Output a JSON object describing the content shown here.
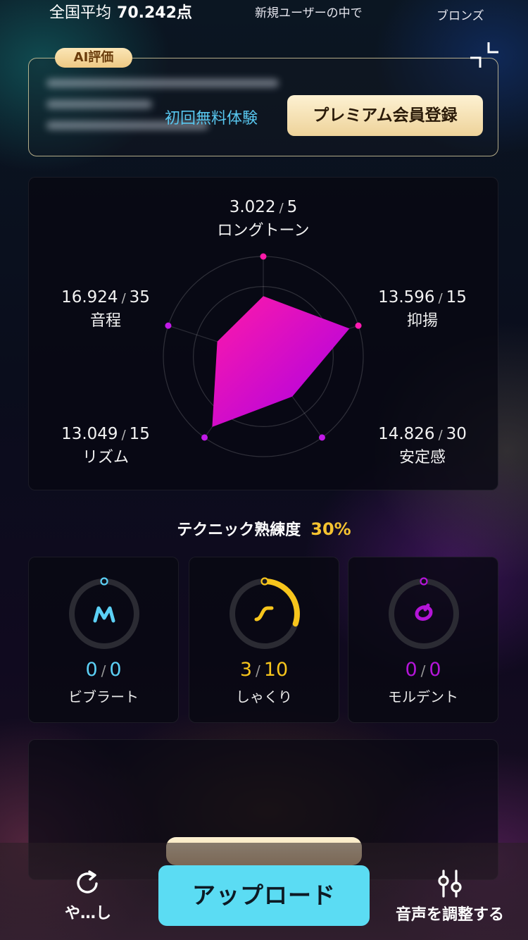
{
  "header": {
    "avg_label": "全国平均",
    "avg_value": "70.242点",
    "subtitle": "新規ユーザーの中で",
    "rank": "ブロンズ"
  },
  "ai_card": {
    "badge": "AI評価",
    "trial_link": "初回無料体験",
    "premium_button": "プレミアム会員登録"
  },
  "radar": {
    "axes": [
      {
        "name": "ロングトーン",
        "score": "3.022",
        "max": "5",
        "ratio": 0.604
      },
      {
        "name": "抑揚",
        "score": "13.596",
        "max": "15",
        "ratio": 0.906
      },
      {
        "name": "安定感",
        "score": "14.826",
        "max": "30",
        "ratio": 0.494
      },
      {
        "name": "リズム",
        "score": "13.049",
        "max": "15",
        "ratio": 0.87
      },
      {
        "name": "音程",
        "score": "16.924",
        "max": "35",
        "ratio": 0.484
      }
    ],
    "fill_colors": [
      "#ff1aa8",
      "#a800e8"
    ]
  },
  "technique": {
    "title": "テクニック熟練度",
    "percent": "30%",
    "items": [
      {
        "name": "ビブラート",
        "count": "0",
        "total": "0",
        "color": "#5cd0f5",
        "progress": 0
      },
      {
        "name": "しゃくり",
        "count": "3",
        "total": "10",
        "color": "#f7c51c",
        "progress": 0.3
      },
      {
        "name": "モルデント",
        "count": "0",
        "total": "0",
        "color": "#b415d8",
        "progress": 0
      }
    ]
  },
  "bottom": {
    "retry_label": "や…し",
    "upload_label": "アップロード",
    "adjust_label": "音声を調整する"
  }
}
